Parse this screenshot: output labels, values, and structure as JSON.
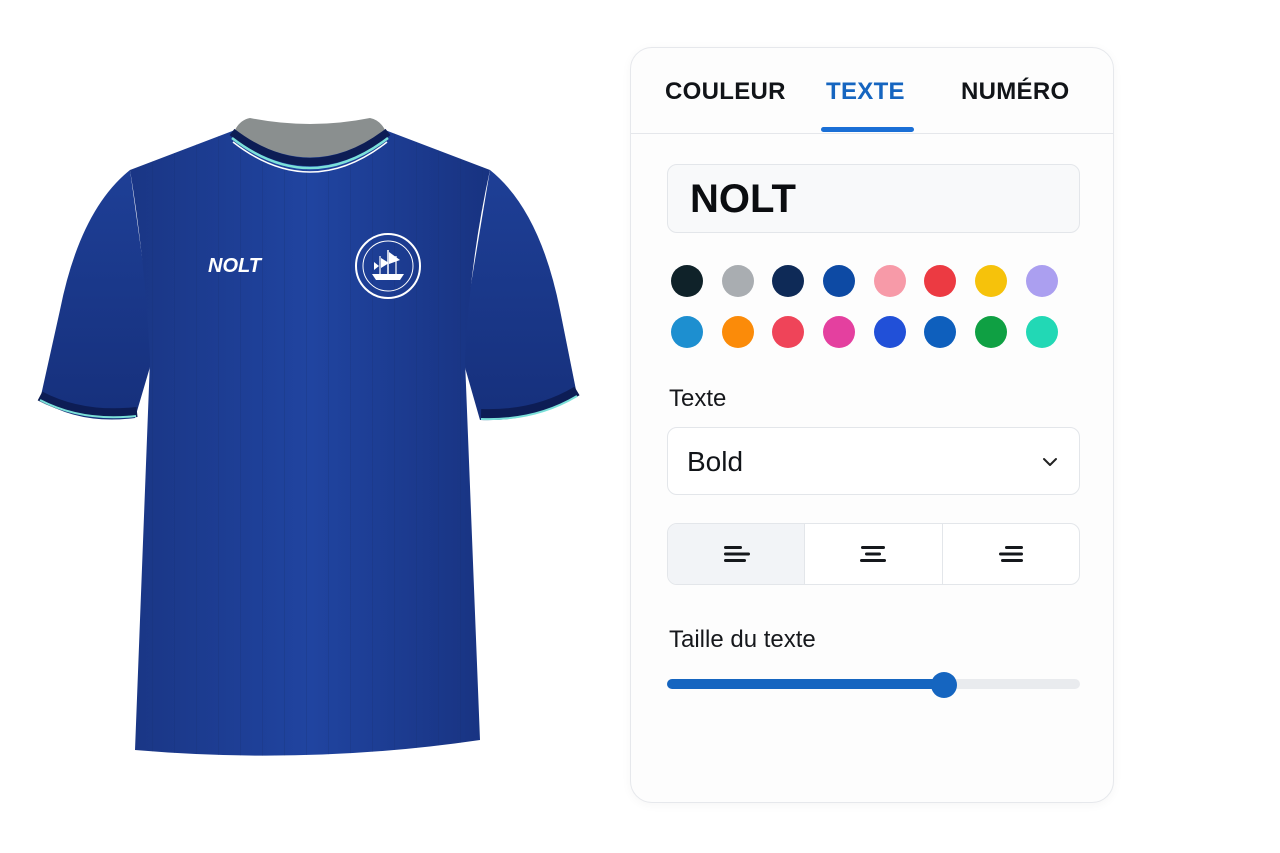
{
  "preview": {
    "jersey_color": "#1e3f94",
    "jersey_brand_text": "NOLT",
    "crest_icon": "ship-crest-icon"
  },
  "tabs": [
    {
      "label": "COULEUR",
      "active": false
    },
    {
      "label": "TEXTE",
      "active": true
    },
    {
      "label": "NUMÉRO",
      "active": false
    }
  ],
  "text_input": {
    "value": "NOLT"
  },
  "swatches": [
    "#0f2229",
    "#a9adb1",
    "#0e2a57",
    "#0d4aa4",
    "#f79aa8",
    "#ec3a42",
    "#f6c20b",
    "#ab9ff0",
    "#1d8fd0",
    "#fb8b09",
    "#ef4459",
    "#e4409f",
    "#2150d8",
    "#0e5fbd",
    "#0fa043",
    "#22d8b5"
  ],
  "font_section": {
    "label": "Texte",
    "selected": "Bold",
    "chevron_icon": "chevron-down-icon"
  },
  "alignment": {
    "options": [
      "align-left",
      "align-center",
      "align-right"
    ],
    "active": "align-left"
  },
  "size_section": {
    "label": "Taille du texte",
    "value_fraction": 0.67
  },
  "colors": {
    "accent": "#1565c0"
  }
}
